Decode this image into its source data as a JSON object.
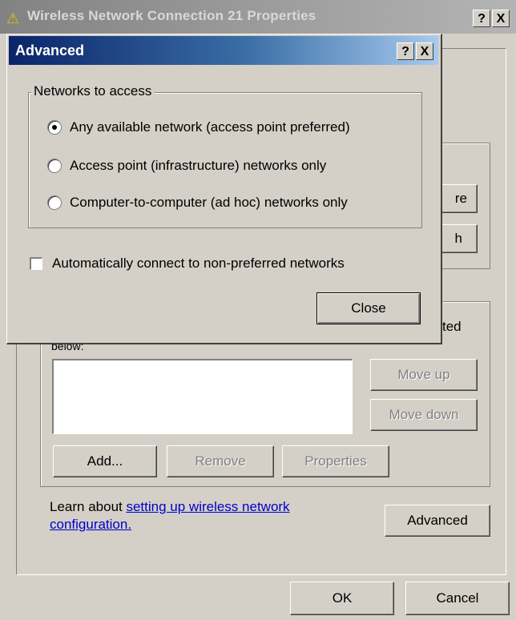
{
  "back_window": {
    "title": "Wireless Network Connection 21 Properties",
    "help_button": "?",
    "close_button": "X",
    "partial_button_1": "re",
    "partial_button_2": "h",
    "partial_label": "ted",
    "below_label": "below:",
    "move_up": "Move up",
    "move_down": "Move down",
    "add": "Add...",
    "remove": "Remove",
    "properties": "Properties",
    "learn_about": "Learn about ",
    "link_text_1": "setting up wireless network",
    "link_text_2": "configuration.",
    "advanced": "Advanced",
    "ok": "OK",
    "cancel": "Cancel"
  },
  "advanced_dialog": {
    "title": "Advanced",
    "help_button": "?",
    "close_button": "X",
    "group_label": "Networks to access",
    "options": [
      {
        "label": "Any available network (access point preferred)",
        "selected": true
      },
      {
        "label": "Access point (infrastructure) networks only",
        "selected": false
      },
      {
        "label": "Computer-to-computer (ad hoc) networks only",
        "selected": false
      }
    ],
    "auto_connect_label": "Automatically connect to non-preferred networks",
    "auto_connect_checked": false,
    "close": "Close"
  }
}
